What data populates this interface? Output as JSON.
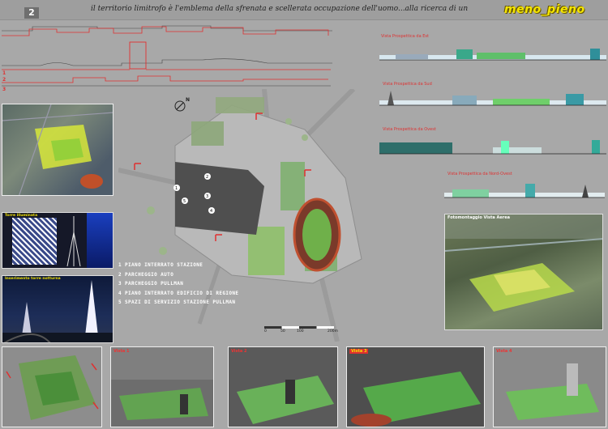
{
  "sheet": {
    "number": "2",
    "subtitle": "il territorio limitrofo è l'emblema della sfrenata e scellerata occupazione dell'uomo...alla ricerca di un",
    "brand": "meno_pieno"
  },
  "sections": {
    "labels": [
      "1",
      "2",
      "3"
    ]
  },
  "elevations": {
    "titles": [
      "Vista Prospettica da Est",
      "Vista Prospettica da Sud",
      "Vista Prospettica da Ovest",
      "Vista Prospettica da Nord-Ovest"
    ]
  },
  "aerial_title": "Fotomontaggio Vista Aerea",
  "left_panels": {
    "tower_lit": "Torre illuminata",
    "tower_night": "Inserimento torre notturna"
  },
  "plan": {
    "numbers": [
      "1",
      "2",
      "3",
      "4",
      "5"
    ],
    "compass_label": "N"
  },
  "legend": [
    {
      "num": "1",
      "label": "PIANO INTERRATO STAZIONE"
    },
    {
      "num": "2",
      "label": "PARCHEGGIO AUTO"
    },
    {
      "num": "3",
      "label": "PARCHEGGIO PULLMAN"
    },
    {
      "num": "4",
      "label": "PIANO INTERRATO EDIFICIO DI REGIONE"
    },
    {
      "num": "5",
      "label": "SPAZI DI SERVIZIO STAZIONE PULLMAN"
    }
  ],
  "scale": {
    "ticks": [
      "0",
      "50",
      "100",
      "200m"
    ]
  },
  "views": [
    "Vista 1",
    "Vista 2",
    "Vista 3",
    "Vista 4"
  ],
  "colors": {
    "accent_red": "#d22a2a",
    "brand_yellow": "#f5e600",
    "green": "#7fd14a"
  }
}
